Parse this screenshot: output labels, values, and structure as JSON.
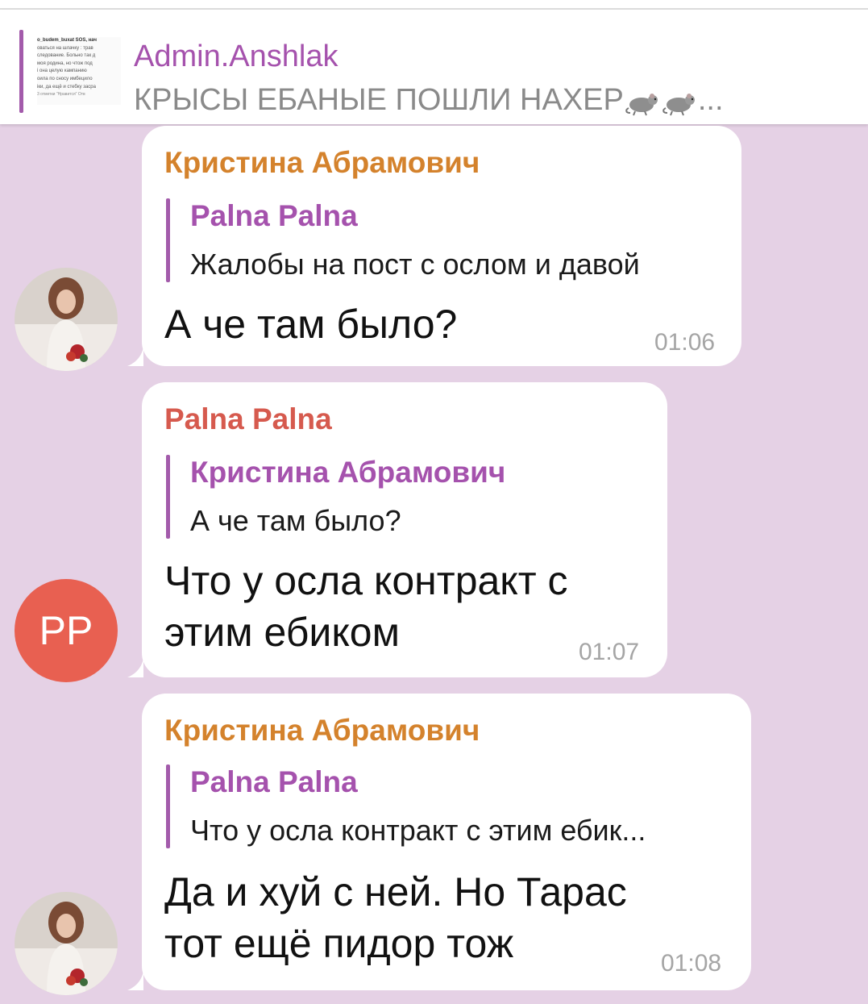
{
  "pinned": {
    "title": "Admin.Anshlak",
    "text": "КРЫСЫ ЕБАНЫЕ ПОШЛИ НАХЕР",
    "text_suffix": "...",
    "rat_icon": "rat-icon",
    "thumb_lines": [
      "o_budem_buxat SOS, нач",
      "оваться на шлачку : трав",
      "следование. Больно так д",
      "моя родина, но чтож под",
      "і она целую кампанию",
      "оила по сносу имбецило",
      "іки, да ещё и стебку засра",
      "3 отметки \"Нравится\"   Отв"
    ]
  },
  "messages": [
    {
      "sender": "Кристина Абрамович",
      "sender_color": "#d4822c",
      "reply_name": "Palna Palna",
      "reply_text": "Жалобы на пост с ослом и давой",
      "text_lines": [
        "А че там было?"
      ],
      "time": "01:06",
      "avatar": "photo"
    },
    {
      "sender": "Palna Palna",
      "sender_color": "#d65a4e",
      "reply_name": "Кристина Абрамович",
      "reply_text": "А че там было?",
      "text_lines": [
        "Что у осла контракт с",
        "этим ебиком"
      ],
      "time": "01:07",
      "avatar": "PP",
      "avatar_color": "#e86051"
    },
    {
      "sender": "Кристина Абрамович",
      "sender_color": "#d4822c",
      "reply_name": "Palna Palna",
      "reply_text": "Что у осла контракт с этим ебик...",
      "text_lines": [
        "Да и хуй с ней. Но Тарас",
        "тот ещё пидор тож"
      ],
      "time": "01:08",
      "avatar": "photo"
    }
  ],
  "colors": {
    "background": "#e5d1e5",
    "accent": "#a552ad",
    "bubble": "#ffffff"
  }
}
